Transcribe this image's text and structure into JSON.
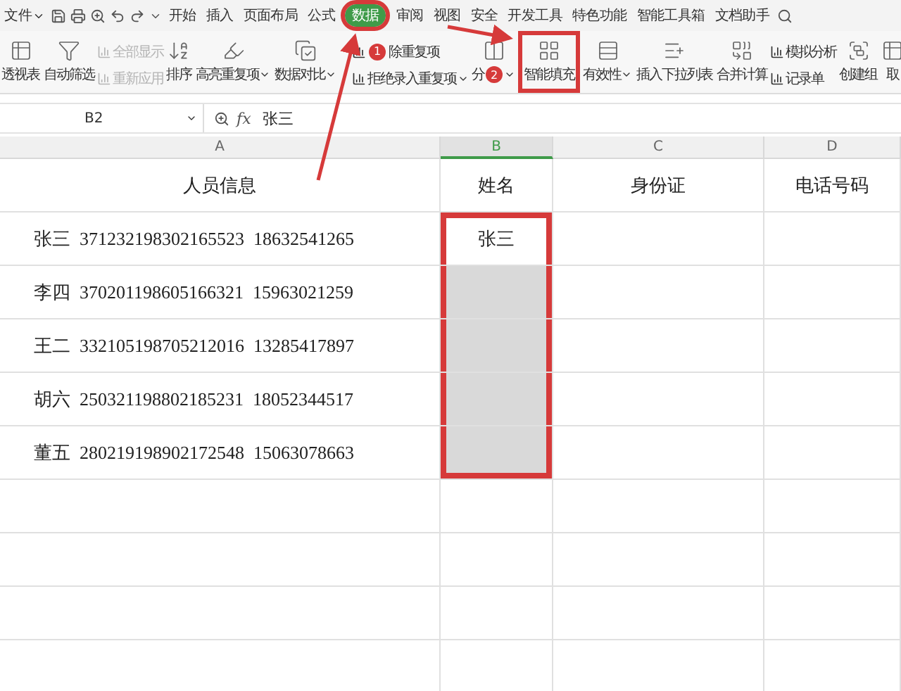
{
  "ribbon": {
    "file_menu": "文件",
    "tabs": [
      {
        "label": "开始",
        "selected": false,
        "highlighted": false
      },
      {
        "label": "插入",
        "selected": false,
        "highlighted": false
      },
      {
        "label": "页面布局",
        "selected": false,
        "highlighted": false
      },
      {
        "label": "公式",
        "selected": false,
        "highlighted": false
      },
      {
        "label": "数据",
        "selected": true,
        "highlighted": true
      },
      {
        "label": "审阅",
        "selected": false,
        "highlighted": false
      },
      {
        "label": "视图",
        "selected": false,
        "highlighted": false
      },
      {
        "label": "安全",
        "selected": false,
        "highlighted": false
      },
      {
        "label": "开发工具",
        "selected": false,
        "highlighted": false
      },
      {
        "label": "特色功能",
        "selected": false,
        "highlighted": false
      },
      {
        "label": "智能工具箱",
        "selected": false,
        "highlighted": false
      },
      {
        "label": "文档助手",
        "selected": false,
        "highlighted": false
      }
    ],
    "tools": [
      {
        "kind": "big",
        "label": "透视表",
        "dropdown": false,
        "highlighted": false
      },
      {
        "kind": "big",
        "label": "自动筛选",
        "dropdown": false,
        "highlighted": false
      },
      {
        "kind": "stack",
        "items": [
          {
            "label": "全部显示",
            "disabled": true,
            "dropdown": false
          },
          {
            "label": "重新应用",
            "disabled": true,
            "dropdown": false
          }
        ]
      },
      {
        "kind": "big",
        "label": "排序",
        "dropdown": false,
        "highlighted": false
      },
      {
        "kind": "big",
        "label": "高亮重复项",
        "dropdown": true,
        "highlighted": false
      },
      {
        "kind": "big",
        "label": "数据对比",
        "dropdown": true,
        "highlighted": false
      },
      {
        "kind": "stack",
        "items": [
          {
            "label": "除重复项",
            "disabled": false,
            "dropdown": false,
            "badge": "1"
          },
          {
            "label": "拒绝录入重复项",
            "disabled": false,
            "dropdown": true
          }
        ]
      },
      {
        "kind": "big",
        "label": "分",
        "dropdown": true,
        "highlighted": false,
        "badge": "2"
      },
      {
        "kind": "big",
        "label": "智能填充",
        "dropdown": false,
        "highlighted": true
      },
      {
        "kind": "big",
        "label": "有效性",
        "dropdown": true,
        "highlighted": false
      },
      {
        "kind": "big",
        "label": "插入下拉列表",
        "dropdown": false,
        "highlighted": false
      },
      {
        "kind": "big",
        "label": "合并计算",
        "dropdown": false,
        "highlighted": false
      },
      {
        "kind": "stack",
        "items": [
          {
            "label": "模拟分析",
            "disabled": false,
            "dropdown": false
          },
          {
            "label": "记录单",
            "disabled": false,
            "dropdown": false
          }
        ]
      },
      {
        "kind": "big",
        "label": "创建组",
        "dropdown": false,
        "highlighted": false
      },
      {
        "kind": "big",
        "label": "取",
        "dropdown": false,
        "highlighted": false
      }
    ]
  },
  "formula_bar": {
    "cell_ref": "B2",
    "function_label": "fx",
    "value": "张三"
  },
  "sheet": {
    "columns": [
      {
        "label": "A",
        "selected": false
      },
      {
        "label": "B",
        "selected": true
      },
      {
        "label": "C",
        "selected": false
      },
      {
        "label": "D",
        "selected": false
      }
    ],
    "rows": [
      {
        "cells": [
          {
            "text": "人员信息",
            "selected": false,
            "outlined": false
          },
          {
            "text": "姓名",
            "selected": false,
            "outlined": false
          },
          {
            "text": "身份证",
            "selected": false,
            "outlined": false
          },
          {
            "text": "电话号码",
            "selected": false,
            "outlined": false
          }
        ]
      },
      {
        "cells": [
          {
            "text": "张三  371232198302165523  18632541265",
            "selected": false,
            "outlined": false
          },
          {
            "text": "张三",
            "selected": false,
            "outlined": true
          },
          {
            "text": "",
            "selected": false,
            "outlined": false
          },
          {
            "text": "",
            "selected": false,
            "outlined": false
          }
        ]
      },
      {
        "cells": [
          {
            "text": "李四  370201198605166321  15963021259",
            "selected": false,
            "outlined": false
          },
          {
            "text": "",
            "selected": true,
            "outlined": true
          },
          {
            "text": "",
            "selected": false,
            "outlined": false
          },
          {
            "text": "",
            "selected": false,
            "outlined": false
          }
        ]
      },
      {
        "cells": [
          {
            "text": "王二  332105198705212016  13285417897",
            "selected": false,
            "outlined": false
          },
          {
            "text": "",
            "selected": true,
            "outlined": true
          },
          {
            "text": "",
            "selected": false,
            "outlined": false
          },
          {
            "text": "",
            "selected": false,
            "outlined": false
          }
        ]
      },
      {
        "cells": [
          {
            "text": "胡六  250321198802185231  18052344517",
            "selected": false,
            "outlined": false
          },
          {
            "text": "",
            "selected": true,
            "outlined": true
          },
          {
            "text": "",
            "selected": false,
            "outlined": false
          },
          {
            "text": "",
            "selected": false,
            "outlined": false
          }
        ]
      },
      {
        "cells": [
          {
            "text": "董五  280219198902172548  15063078663",
            "selected": false,
            "outlined": false
          },
          {
            "text": "",
            "selected": true,
            "outlined": true
          },
          {
            "text": "",
            "selected": false,
            "outlined": false
          },
          {
            "text": "",
            "selected": false,
            "outlined": false
          }
        ]
      }
    ]
  }
}
